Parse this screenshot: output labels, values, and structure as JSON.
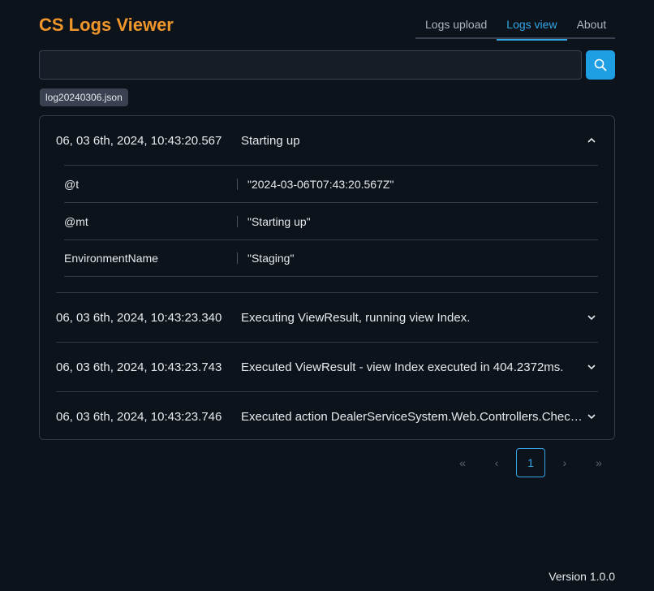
{
  "app": {
    "title": "CS Logs Viewer"
  },
  "nav": {
    "tabs": [
      "Logs upload",
      "Logs view",
      "About"
    ],
    "active": "Logs view"
  },
  "search": {
    "value": "",
    "placeholder": "",
    "icon": "search-icon"
  },
  "file_chip": "log20240306.json",
  "logs": [
    {
      "time": "06, 03 6th, 2024, 10:43:20.567",
      "message": "Starting up",
      "expanded": true,
      "props": [
        {
          "key": "@t",
          "value": "\"2024-03-06T07:43:20.567Z\""
        },
        {
          "key": "@mt",
          "value": "\"Starting up\""
        },
        {
          "key": "EnvironmentName",
          "value": "\"Staging\""
        }
      ]
    },
    {
      "time": "06, 03 6th, 2024, 10:43:23.340",
      "message": "Executing ViewResult, running view Index.",
      "expanded": false
    },
    {
      "time": "06, 03 6th, 2024, 10:43:23.743",
      "message": "Executed ViewResult - view Index executed in 404.2372ms.",
      "expanded": false
    },
    {
      "time": "06, 03 6th, 2024, 10:43:23.746",
      "message": "Executed action DealerServiceSystem.Web.Controllers.CheckController.Index (DealerServiceSystem.Web)",
      "expanded": false
    }
  ],
  "pagination": {
    "first": "«",
    "prev": "‹",
    "current": "1",
    "next": "›",
    "last": "»"
  },
  "footer": {
    "version": "Version 1.0.0"
  },
  "colors": {
    "accent": "#33a7e6",
    "brand": "#f0962a",
    "background": "#0d131b"
  }
}
